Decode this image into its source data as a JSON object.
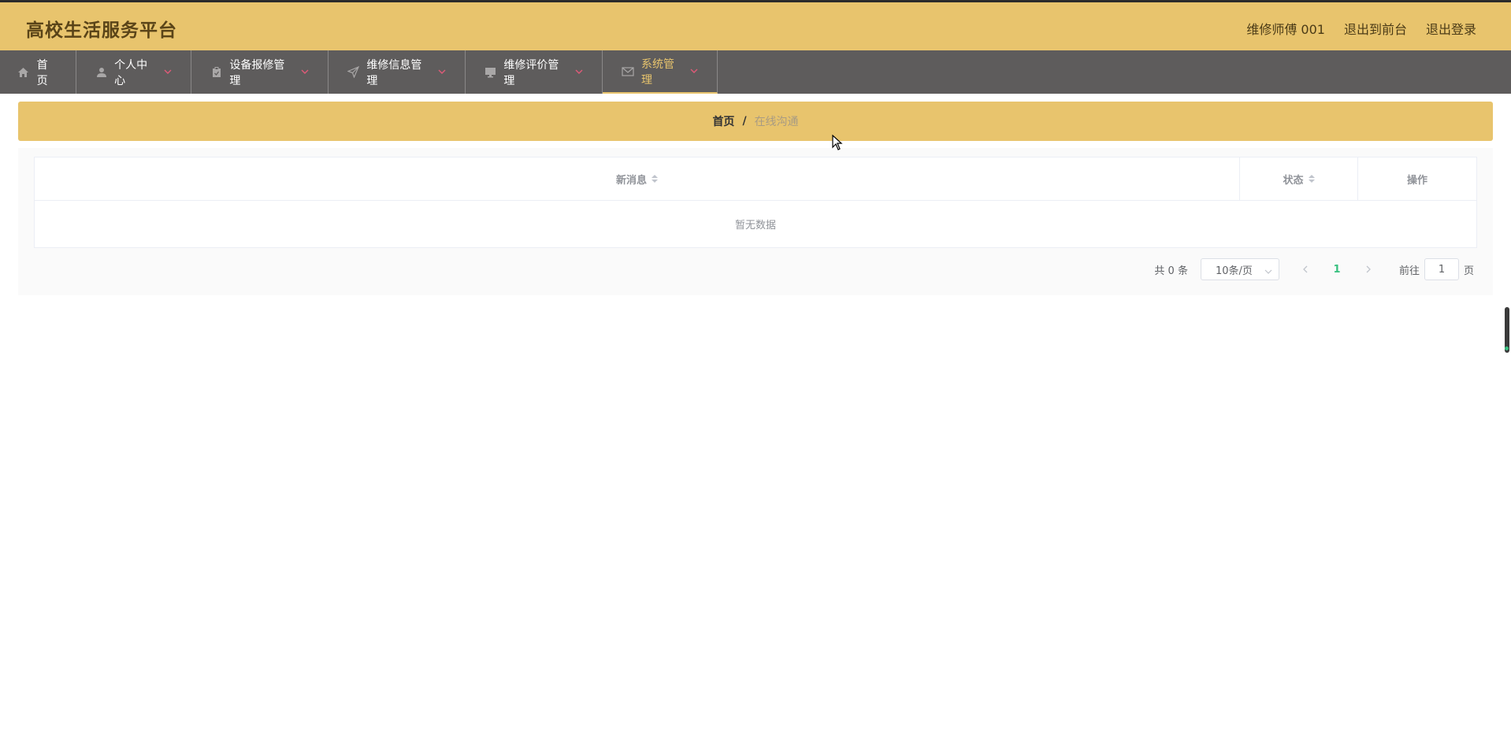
{
  "header": {
    "brand": "高校生活服务平台",
    "user": "维修师傅 001",
    "to_front": "退出到前台",
    "logout": "退出登录",
    "accent_color": "#e8c46d"
  },
  "nav": {
    "items": [
      {
        "label": "首页",
        "icon": "home-icon"
      },
      {
        "label": "个人中心",
        "icon": "user-icon"
      },
      {
        "label": "设备报修管理",
        "icon": "clipboard-icon"
      },
      {
        "label": "维修信息管理",
        "icon": "send-icon"
      },
      {
        "label": "维修评价管理",
        "icon": "monitor-icon"
      },
      {
        "label": "系统管理",
        "icon": "mail-icon",
        "active": true
      }
    ]
  },
  "breadcrumb": {
    "home": "首页",
    "separator": "/",
    "current": "在线沟通"
  },
  "table": {
    "columns": [
      "新消息",
      "状态",
      "操作"
    ],
    "empty_text": "暂无数据"
  },
  "pagination": {
    "total_text": "共 0 条",
    "page_size": "10条/页",
    "current_page": "1",
    "goto_prefix": "前往",
    "goto_value": "1",
    "goto_suffix": "页"
  }
}
